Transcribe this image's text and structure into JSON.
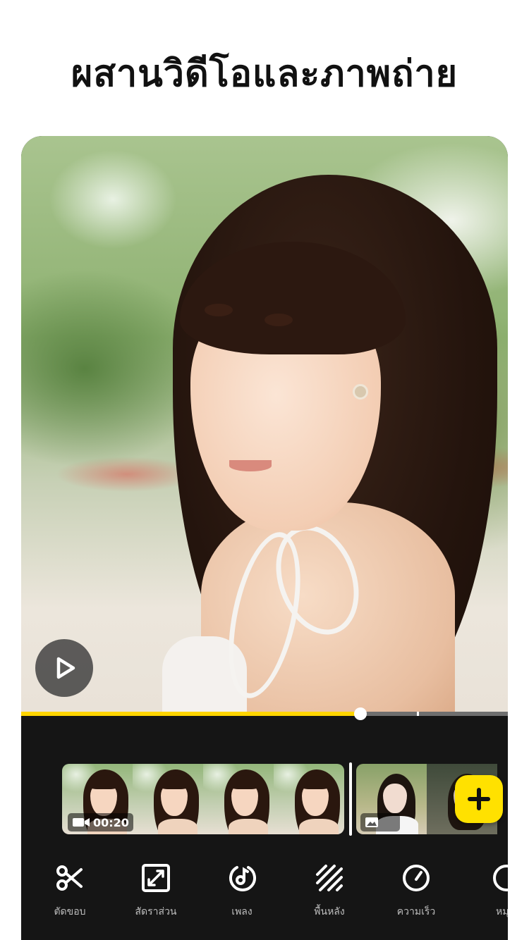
{
  "headline": "ผสานวิดีโอและภาพถ่าย",
  "preview": {
    "playback_progress": 0.697,
    "clip_boundary": 0.813
  },
  "timeline": {
    "video_clip": {
      "duration": "00:20",
      "icon": "video-camera-icon",
      "frame_count": 4
    },
    "photo_clip": {
      "icon": "image-icon"
    },
    "add_icon": "plus-icon"
  },
  "toolbar": {
    "items": [
      {
        "label": "ตัดขอบ",
        "icon": "scissors-icon"
      },
      {
        "label": "สัดราส่วน",
        "icon": "aspect-ratio-icon"
      },
      {
        "label": "เพลง",
        "icon": "music-icon"
      },
      {
        "label": "พื้นหลัง",
        "icon": "background-icon"
      },
      {
        "label": "ความเร็ว",
        "icon": "speed-icon"
      },
      {
        "label": "หมุ",
        "icon": "rotate-icon"
      }
    ]
  },
  "colors": {
    "accent": "#ffd500",
    "panel": "#151515",
    "label": "#bdbdbd"
  }
}
